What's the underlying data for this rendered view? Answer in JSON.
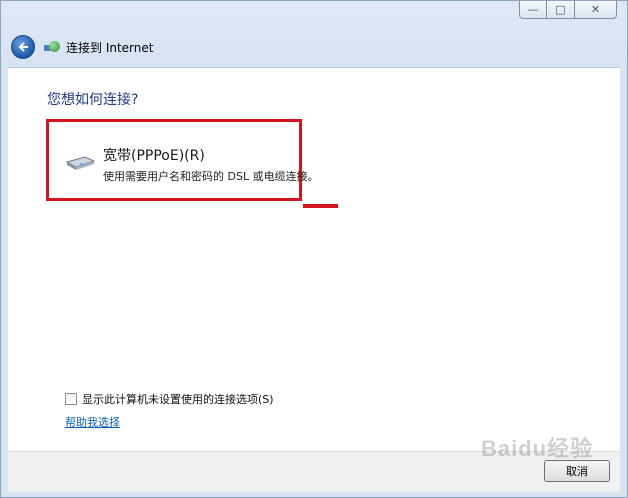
{
  "window": {
    "caption_buttons": {
      "minimize": "—",
      "maximize": "□",
      "close": "✕"
    },
    "nav_title": "连接到 Internet",
    "icons": {
      "back": "back-arrow-icon",
      "network": "network-globe-icon"
    }
  },
  "main": {
    "heading": "您想如何连接?",
    "option": {
      "title": "宽带(PPPoE)(R)",
      "description": "使用需要用户名和密码的 DSL 或电缆连接。",
      "icon": "modem-icon"
    },
    "checkbox_label": "显示此计算机未设置使用的连接选项(S)",
    "checkbox_checked": false,
    "help_link": "帮助我选择"
  },
  "footer": {
    "cancel_label": "取消"
  },
  "watermark": "Baidu经验",
  "colors": {
    "highlight_border": "#d4141c",
    "heading": "#1e3a8a",
    "link": "#0b5fb7"
  }
}
